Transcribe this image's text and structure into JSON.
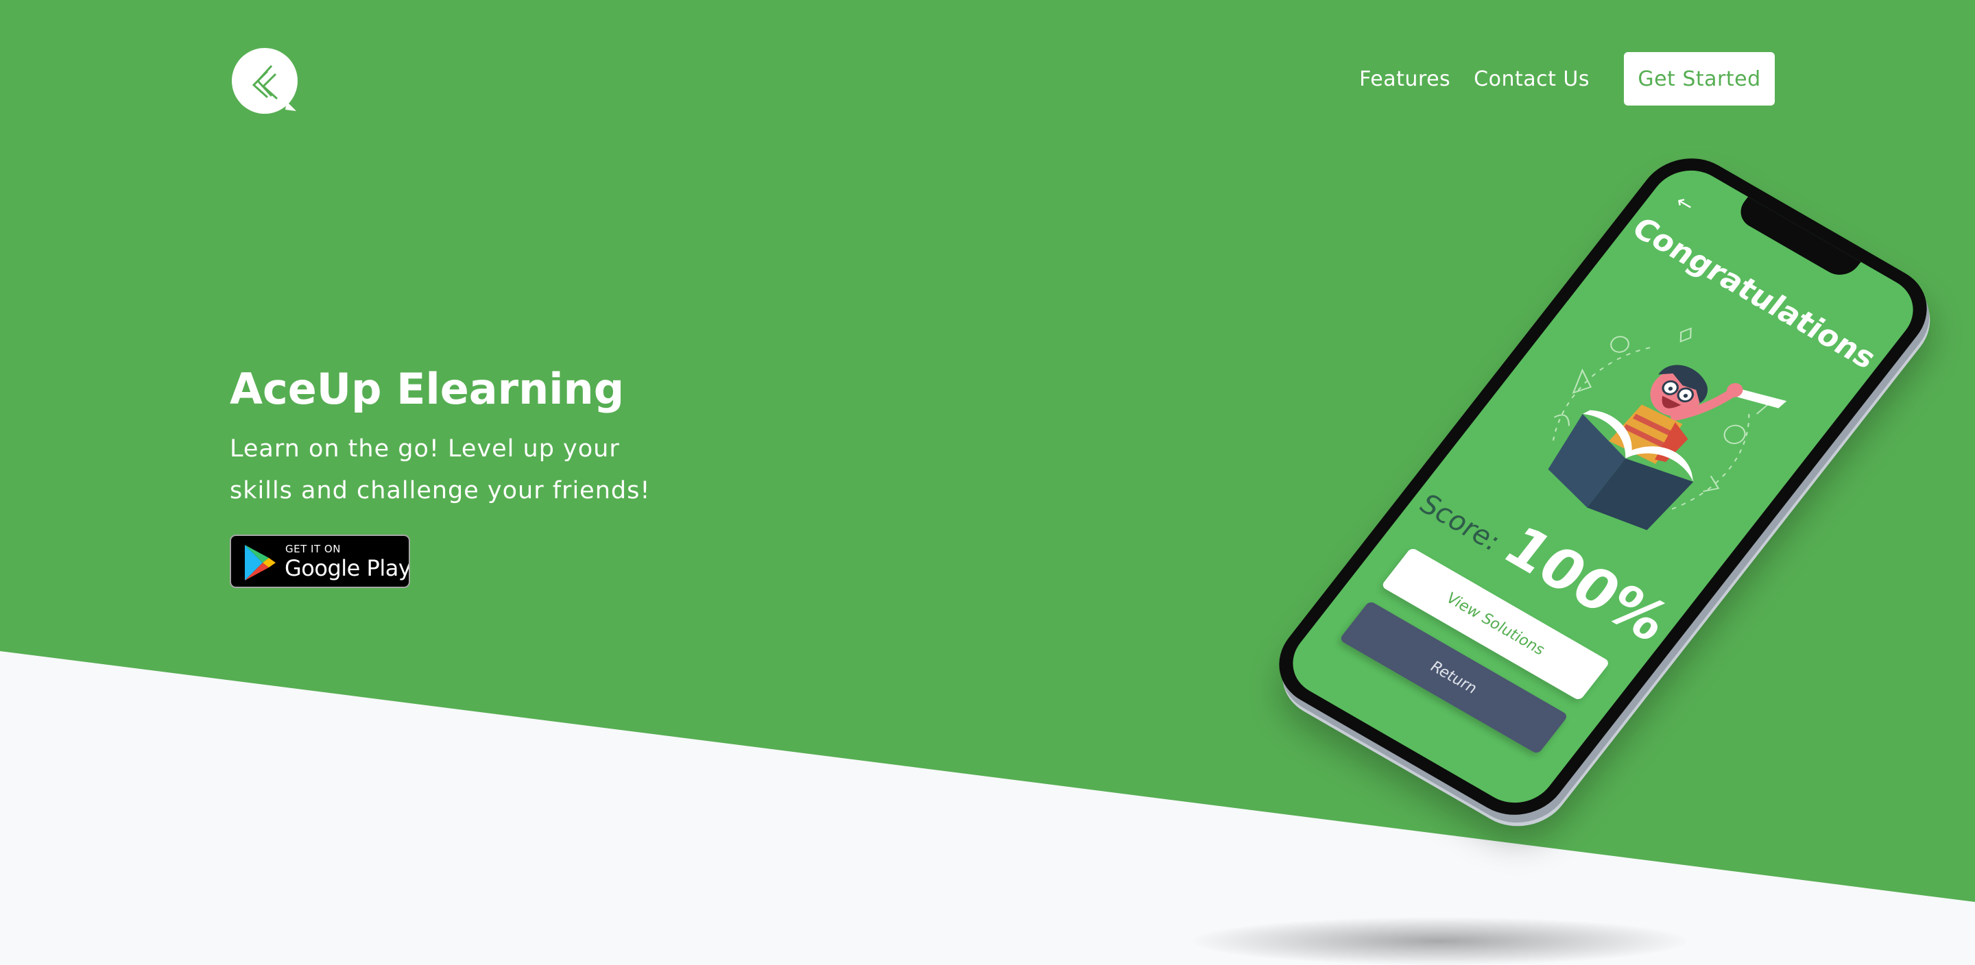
{
  "nav": {
    "features_label": "Features",
    "contact_label": "Contact Us",
    "cta_label": "Get Started"
  },
  "hero": {
    "title": "AceUp Elearning",
    "subtitle": "Learn on the go! Level up your skills and challenge your friends!",
    "badge_top": "GET IT ON",
    "badge_main": "Google Play"
  },
  "phone": {
    "heading": "Congratulations",
    "score_label": "Score:",
    "score_value": "100%",
    "view_solutions_label": "View Solutions",
    "return_label": "Return"
  },
  "icons": {
    "logo": "chevron-arrows-logo",
    "badge": "google-play-icon",
    "back": "back-arrow-icon"
  },
  "colors": {
    "brand_green": "#56ae52",
    "screen_green": "#5abc5e",
    "page_background": "#f7f9fb",
    "return_button": "#4a5570",
    "white": "#ffffff"
  }
}
